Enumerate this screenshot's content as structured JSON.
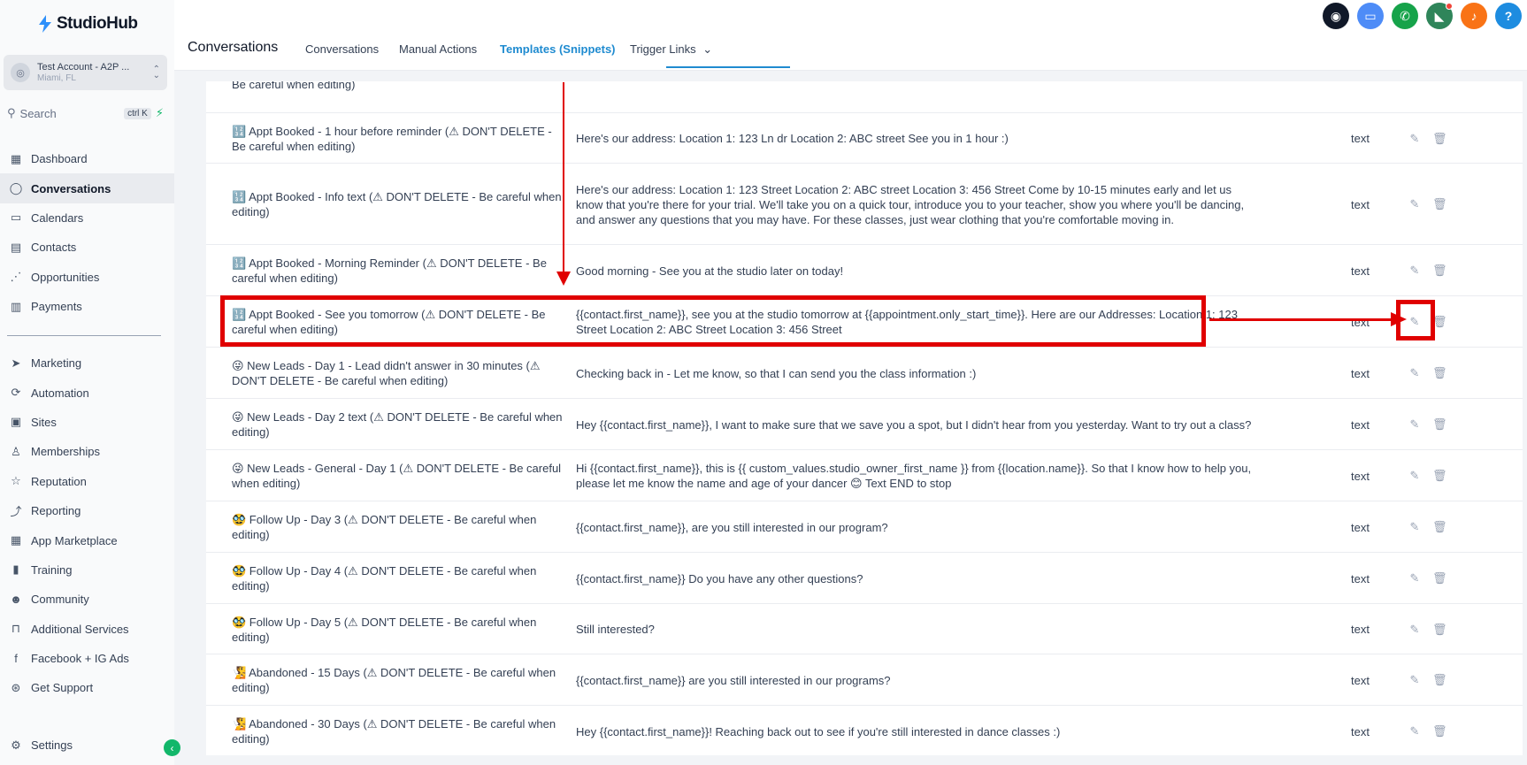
{
  "app": {
    "brand": "StudioHub"
  },
  "account": {
    "name": "Test Account - A2P ...",
    "location": "Miami, FL"
  },
  "search": {
    "label": "Search",
    "shortcut": "ctrl K"
  },
  "nav": [
    {
      "label": "Dashboard",
      "icon": "dashboard-icon",
      "active": false
    },
    {
      "label": "Conversations",
      "icon": "chat-icon",
      "active": true
    },
    {
      "label": "Calendars",
      "icon": "calendar-icon",
      "active": false
    },
    {
      "label": "Contacts",
      "icon": "contacts-icon",
      "active": false
    },
    {
      "label": "Opportunities",
      "icon": "funnel-icon",
      "active": false
    },
    {
      "label": "Payments",
      "icon": "payments-icon",
      "active": false
    }
  ],
  "nav2": [
    {
      "label": "Marketing",
      "icon": "send-icon"
    },
    {
      "label": "Automation",
      "icon": "automation-icon"
    },
    {
      "label": "Sites",
      "icon": "sites-icon"
    },
    {
      "label": "Memberships",
      "icon": "membership-icon"
    },
    {
      "label": "Reputation",
      "icon": "star-icon"
    },
    {
      "label": "Reporting",
      "icon": "reporting-icon"
    },
    {
      "label": "App Marketplace",
      "icon": "apps-icon"
    },
    {
      "label": "Training",
      "icon": "book-icon"
    },
    {
      "label": "Community",
      "icon": "community-icon"
    },
    {
      "label": "Additional Services",
      "icon": "cart-icon"
    },
    {
      "label": "Facebook + IG Ads",
      "icon": "facebook-icon"
    },
    {
      "label": "Get Support",
      "icon": "support-icon"
    }
  ],
  "settings": {
    "label": "Settings"
  },
  "header": {
    "title": "Conversations",
    "tabs": [
      {
        "label": "Conversations",
        "active": false
      },
      {
        "label": "Manual Actions",
        "active": false
      },
      {
        "label": "Templates (Snippets)",
        "active": true
      },
      {
        "label": "Trigger Links",
        "active": false,
        "dropdown": true
      }
    ]
  },
  "top_icons": [
    {
      "name": "robot-icon",
      "color": "#101828",
      "glyph": "◉"
    },
    {
      "name": "message-icon",
      "color": "#4e8cf7",
      "glyph": "▭"
    },
    {
      "name": "phone-icon",
      "color": "#16a34a",
      "glyph": "✆"
    },
    {
      "name": "megaphone-icon",
      "color": "#2f855a",
      "glyph": "◣"
    },
    {
      "name": "bell-icon",
      "color": "#f97316",
      "glyph": "♪"
    },
    {
      "name": "help-icon",
      "color": "#1d8ce0",
      "glyph": "?"
    }
  ],
  "partial_row": {
    "name": "Be careful when editing)"
  },
  "templates": [
    {
      "name": "🔢 Appt Booked - 1 hour before reminder (⚠ DON'T DELETE - Be careful when editing)",
      "body": "Here's our address: Location 1: 123 Ln dr Location 2: ABC street See you in 1 hour :)",
      "type": "text"
    },
    {
      "name": "🔢 Appt Booked - Info text (⚠ DON'T DELETE - Be careful when editing)",
      "body": "Here's our address: Location 1: 123 Street Location 2: ABC street Location 3: 456 Street Come by 10-15 minutes early and let us know that you're there for your trial. We'll take you on a quick tour, introduce you to your teacher, show you where you'll be dancing, and answer any questions that you may have. For these classes, just wear clothing that you're comfortable moving in.",
      "type": "text"
    },
    {
      "name": "🔢 Appt Booked - Morning Reminder (⚠ DON'T DELETE - Be careful when editing)",
      "body": "Good morning - See you at the studio later on today!",
      "type": "text"
    },
    {
      "name": "🔢 Appt Booked - See you tomorrow (⚠ DON'T DELETE - Be careful when editing)",
      "body": "{{contact.first_name}}, see you at the studio tomorrow at {{appointment.only_start_time}}. Here are our Addresses: Location 1: 123 Street Location 2: ABC Street Location 3: 456 Street",
      "type": "text"
    },
    {
      "name": "😜 New Leads - Day 1 - Lead didn't answer in 30 minutes (⚠ DON'T DELETE - Be careful when editing)",
      "body": "Checking back in - Let me know, so that I can send you the class information :)",
      "type": "text"
    },
    {
      "name": "😜 New Leads - Day 2 text (⚠ DON'T DELETE - Be careful when editing)",
      "body": "Hey {{contact.first_name}}, I want to make sure that we save you a spot, but I didn't hear from you yesterday. Want to try out a class?",
      "type": "text"
    },
    {
      "name": "😜 New Leads - General - Day 1 (⚠ DON'T DELETE - Be careful when editing)",
      "body": "Hi {{contact.first_name}}, this is {{ custom_values.studio_owner_first_name }} from {{location.name}}. So that I know how to help you, please let me know the name and age of your dancer 😊 Text END to stop",
      "type": "text"
    },
    {
      "name": "🥸 Follow Up - Day 3 (⚠ DON'T DELETE - Be careful when editing)",
      "body": "{{contact.first_name}}, are you still interested in our program?",
      "type": "text"
    },
    {
      "name": "🥸 Follow Up - Day 4 (⚠ DON'T DELETE - Be careful when editing)",
      "body": "{{contact.first_name}} Do you have any other questions?",
      "type": "text"
    },
    {
      "name": "🥸 Follow Up - Day 5 (⚠ DON'T DELETE - Be careful when editing)",
      "body": "Still interested?",
      "type": "text"
    },
    {
      "name": "🧏 Abandoned - 15 Days (⚠ DON'T DELETE - Be careful when editing)",
      "body": "{{contact.first_name}} are you still interested in our programs?",
      "type": "text"
    },
    {
      "name": "🧏 Abandoned - 30 Days (⚠ DON'T DELETE - Be careful when editing)",
      "body": "Hey {{contact.first_name}}! Reaching back out to see if you're still interested in dance classes :)",
      "type": "text"
    }
  ],
  "colors": {
    "accent": "#1f8bd0",
    "annotation": "#e00000",
    "success": "#12b76a"
  }
}
